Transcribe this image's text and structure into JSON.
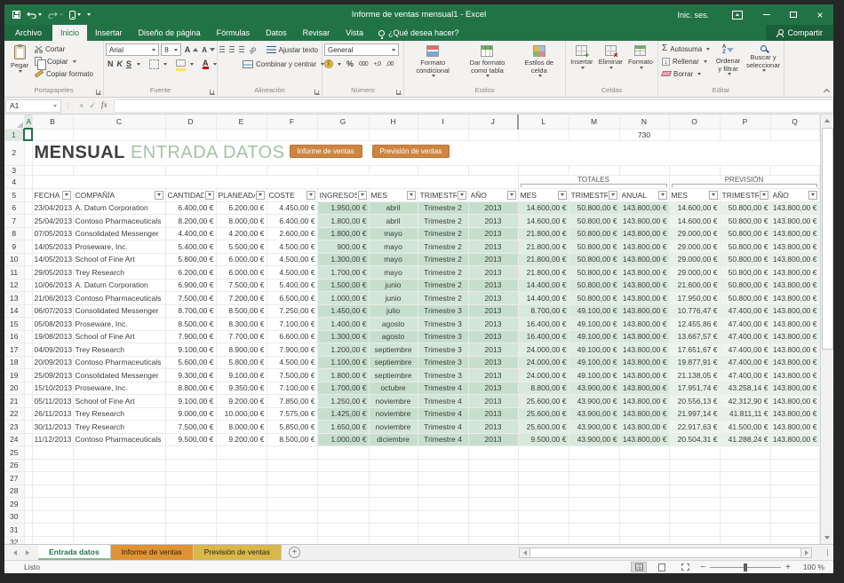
{
  "window": {
    "title": "Informe de ventas mensual1 - Excel",
    "sign_in": "Inic. ses.",
    "share_label": "Compartir"
  },
  "menu_tabs": [
    {
      "label": "Archivo",
      "type": "file"
    },
    {
      "label": "Inicio",
      "type": "active"
    },
    {
      "label": "Insertar",
      "type": "normal"
    },
    {
      "label": "Diseño de página",
      "type": "normal"
    },
    {
      "label": "Fórmulas",
      "type": "normal"
    },
    {
      "label": "Datos",
      "type": "normal"
    },
    {
      "label": "Revisar",
      "type": "normal"
    },
    {
      "label": "Vista",
      "type": "normal"
    }
  ],
  "tell_me": "¿Qué desea hacer?",
  "ribbon": {
    "clipboard": {
      "label": "Portapapeles",
      "paste": "Pegar",
      "cut": "Cortar",
      "copy": "Copiar",
      "format_painter": "Copiar formato"
    },
    "font": {
      "label": "Fuente",
      "family": "Arial",
      "size": "8",
      "bold": "N",
      "italic": "K",
      "underline": "S"
    },
    "alignment": {
      "label": "Alineación",
      "wrap_text": "Ajustar texto",
      "merge_center": "Combinar y centrar"
    },
    "number": {
      "label": "Número",
      "format": "General",
      "percent": "%",
      "thousands": "000",
      "dec_inc": "+,0",
      "dec_dec": ",00"
    },
    "styles": {
      "label": "Estilos",
      "conditional": "Formato condicional",
      "as_table": "Dar formato como tabla",
      "cell_styles": "Estilos de celda"
    },
    "cells": {
      "label": "Celdas",
      "insert": "Insertar",
      "delete": "Eliminar",
      "format": "Formato"
    },
    "editing": {
      "label": "Editar",
      "autosum": "Autosuma",
      "fill": "Rellenar",
      "clear": "Borrar",
      "sort": "Ordenar y filtrar",
      "find": "Buscar y seleccionar"
    }
  },
  "formula_bar": {
    "name_box": "A1",
    "fx": "fx",
    "formula": ""
  },
  "grid": {
    "col_letters": [
      "A",
      "B",
      "C",
      "D",
      "E",
      "F",
      "G",
      "H",
      "I",
      "J",
      "L",
      "M",
      "N",
      "O",
      "P",
      "Q"
    ],
    "row_count": 32,
    "free_value": "730",
    "title": {
      "bold": "MENSUAL",
      "light": "ENTRADA DATOS"
    },
    "sheet_buttons": [
      "Informe de ventas",
      "Previsión de ventas"
    ],
    "totals_label": "TOTALES",
    "forecast_label": "PREVISIÓN",
    "table_headers": [
      "FECHA",
      "COMPAÑÍA",
      "CANTIDAD",
      "PLANEADA",
      "COSTE",
      "INGRESOS",
      "MES",
      "TRIMESTRE",
      "AÑO",
      "MES",
      "TRIMESTRE",
      "ANUAL",
      "MES",
      "TRIMESTRE",
      "AÑO"
    ],
    "rows": [
      [
        "23/04/2013",
        "A. Datum Corporation",
        "6.400,00 €",
        "6.200,00 €",
        "4.450,00 €",
        "1.950,00 €",
        "abril",
        "Trimestre 2",
        "2013",
        "14.600,00 €",
        "50.800,00 €",
        "143.800,00 €",
        "14.600,00 €",
        "50.800,00 €",
        "143.800,00 €"
      ],
      [
        "25/04/2013",
        "Contoso Pharmaceuticals",
        "8.200,00 €",
        "8.000,00 €",
        "6.400,00 €",
        "1.800,00 €",
        "abril",
        "Trimestre 2",
        "2013",
        "14.600,00 €",
        "50.800,00 €",
        "143.800,00 €",
        "14.600,00 €",
        "50.800,00 €",
        "143.800,00 €"
      ],
      [
        "07/05/2013",
        "Consolidated Messenger",
        "4.400,00 €",
        "4.200,00 €",
        "2.600,00 €",
        "1.800,00 €",
        "mayo",
        "Trimestre 2",
        "2013",
        "21.800,00 €",
        "50.800,00 €",
        "143.800,00 €",
        "29.000,00 €",
        "50.800,00 €",
        "143.800,00 €"
      ],
      [
        "14/05/2013",
        "Proseware, Inc.",
        "5.400,00 €",
        "5.500,00 €",
        "4.500,00 €",
        "900,00 €",
        "mayo",
        "Trimestre 2",
        "2013",
        "21.800,00 €",
        "50.800,00 €",
        "143.800,00 €",
        "29.000,00 €",
        "50.800,00 €",
        "143.800,00 €"
      ],
      [
        "14/05/2013",
        "School of Fine Art",
        "5.800,00 €",
        "6.000,00 €",
        "4.500,00 €",
        "1.300,00 €",
        "mayo",
        "Trimestre 2",
        "2013",
        "21.800,00 €",
        "50.800,00 €",
        "143.800,00 €",
        "29.000,00 €",
        "50.800,00 €",
        "143.800,00 €"
      ],
      [
        "29/05/2013",
        "Trey Research",
        "6.200,00 €",
        "6.000,00 €",
        "4.500,00 €",
        "1.700,00 €",
        "mayo",
        "Trimestre 2",
        "2013",
        "21.800,00 €",
        "50.800,00 €",
        "143.800,00 €",
        "29.000,00 €",
        "50.800,00 €",
        "143.800,00 €"
      ],
      [
        "10/06/2013",
        "A. Datum Corporation",
        "6.900,00 €",
        "7.500,00 €",
        "5.400,00 €",
        "1.500,00 €",
        "junio",
        "Trimestre 2",
        "2013",
        "14.400,00 €",
        "50.800,00 €",
        "143.800,00 €",
        "21.600,00 €",
        "50.800,00 €",
        "143.800,00 €"
      ],
      [
        "21/06/2013",
        "Contoso Pharmaceuticals",
        "7.500,00 €",
        "7.200,00 €",
        "6.500,00 €",
        "1.000,00 €",
        "junio",
        "Trimestre 2",
        "2013",
        "14.400,00 €",
        "50.800,00 €",
        "143.800,00 €",
        "17.950,00 €",
        "50.800,00 €",
        "143.800,00 €"
      ],
      [
        "06/07/2013",
        "Consolidated Messenger",
        "8.700,00 €",
        "8.500,00 €",
        "7.250,00 €",
        "1.450,00 €",
        "julio",
        "Trimestre 3",
        "2013",
        "8.700,00 €",
        "49.100,00 €",
        "143.800,00 €",
        "10.776,47 €",
        "47.400,00 €",
        "143.800,00 €"
      ],
      [
        "05/08/2013",
        "Proseware, Inc.",
        "8.500,00 €",
        "8.300,00 €",
        "7.100,00 €",
        "1.400,00 €",
        "agosto",
        "Trimestre 3",
        "2013",
        "16.400,00 €",
        "49.100,00 €",
        "143.800,00 €",
        "12.455,86 €",
        "47.400,00 €",
        "143.800,00 €"
      ],
      [
        "19/08/2013",
        "School of Fine Art",
        "7.900,00 €",
        "7.700,00 €",
        "6.600,00 €",
        "1.300,00 €",
        "agosto",
        "Trimestre 3",
        "2013",
        "16.400,00 €",
        "49.100,00 €",
        "143.800,00 €",
        "13.667,57 €",
        "47.400,00 €",
        "143.800,00 €"
      ],
      [
        "04/09/2013",
        "Trey Research",
        "9.100,00 €",
        "8.900,00 €",
        "7.900,00 €",
        "1.200,00 €",
        "septiembre",
        "Trimestre 3",
        "2013",
        "24.000,00 €",
        "49.100,00 €",
        "143.800,00 €",
        "17.651,67 €",
        "47.400,00 €",
        "143.800,00 €"
      ],
      [
        "20/09/2013",
        "Contoso Pharmaceuticals",
        "5.600,00 €",
        "5.800,00 €",
        "4.500,00 €",
        "1.100,00 €",
        "septiembre",
        "Trimestre 3",
        "2013",
        "24.000,00 €",
        "49.100,00 €",
        "143.800,00 €",
        "19.877,91 €",
        "47.400,00 €",
        "143.800,00 €"
      ],
      [
        "25/09/2013",
        "Consolidated Messenger",
        "9.300,00 €",
        "9.100,00 €",
        "7.500,00 €",
        "1.800,00 €",
        "septiembre",
        "Trimestre 3",
        "2013",
        "24.000,00 €",
        "49.100,00 €",
        "143.800,00 €",
        "21.138,05 €",
        "47.400,00 €",
        "143.800,00 €"
      ],
      [
        "15/10/2013",
        "Proseware, Inc.",
        "8.800,00 €",
        "9.350,00 €",
        "7.100,00 €",
        "1.700,00 €",
        "octubre",
        "Trimestre 4",
        "2013",
        "8.800,00 €",
        "43.900,00 €",
        "143.800,00 €",
        "17.951,74 €",
        "43.258,14 €",
        "143.800,00 €"
      ],
      [
        "05/11/2013",
        "School of Fine Art",
        "9.100,00 €",
        "9.200,00 €",
        "7.850,00 €",
        "1.250,00 €",
        "noviembre",
        "Trimestre 4",
        "2013",
        "25.600,00 €",
        "43.900,00 €",
        "143.800,00 €",
        "20.556,13 €",
        "42.312,90 €",
        "143.800,00 €"
      ],
      [
        "26/11/2013",
        "Trey Research",
        "9.000,00 €",
        "10.000,00 €",
        "7.575,00 €",
        "1.425,00 €",
        "noviembre",
        "Trimestre 4",
        "2013",
        "25.600,00 €",
        "43.900,00 €",
        "143.800,00 €",
        "21.997,14 €",
        "41.811,11 €",
        "143.800,00 €"
      ],
      [
        "30/11/2013",
        "Trey Research",
        "7.500,00 €",
        "8.000,00 €",
        "5.850,00 €",
        "1.650,00 €",
        "noviembre",
        "Trimestre 4",
        "2013",
        "25.600,00 €",
        "43.900,00 €",
        "143.800,00 €",
        "22.917,63 €",
        "41.500,00 €",
        "143.800,00 €"
      ],
      [
        "11/12/2013",
        "Contoso Pharmaceuticals",
        "9.500,00 €",
        "9.200,00 €",
        "8.500,00 €",
        "1.000,00 €",
        "diciembre",
        "Trimestre 4",
        "2013",
        "9.500,00 €",
        "43.900,00 €",
        "143.800,00 €",
        "20.504,31 €",
        "41.288,24 €",
        "143.800,00 €"
      ]
    ]
  },
  "sheet_tabs": {
    "tabs": [
      {
        "label": "Entrada datos",
        "state": "active"
      },
      {
        "label": "Informe de ventas",
        "state": "orange"
      },
      {
        "label": "Previsión de ventas",
        "state": "gold"
      }
    ]
  },
  "status": {
    "mode": "Listo",
    "zoom_level": "100 %"
  },
  "colors": {
    "accent": "#217346",
    "sheet_button": "#cd8540",
    "tab_orange": "#de9335",
    "tab_gold": "#d8b84b",
    "title_light": "#a2c4a5",
    "table_header_text": "#b97b35"
  }
}
